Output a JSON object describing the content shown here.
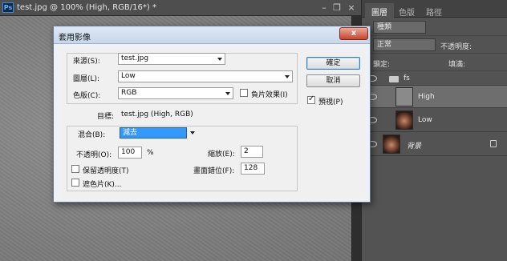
{
  "document": {
    "tab_title": "test.jpg @ 100% (High, RGB/16*) *",
    "app_icon": "Ps",
    "minimize": "–",
    "restore": "❐",
    "close": "×"
  },
  "layers_panel": {
    "tabs": [
      "圖層",
      "色版",
      "路徑"
    ],
    "filter_label": "種類",
    "blend_mode": "正常",
    "opacity_label": "不透明度:",
    "lock_label": "鎖定:",
    "fill_label": "填滿:",
    "layers": [
      {
        "name": "fs",
        "type": "group"
      },
      {
        "name": "High",
        "type": "layer"
      },
      {
        "name": "Low",
        "type": "layer"
      },
      {
        "name": "背景",
        "type": "background"
      }
    ]
  },
  "dialog": {
    "title": "套用影像",
    "close_label": "x",
    "source_label": "來源(S):",
    "source_value": "test.jpg",
    "layer_label": "圖層(L):",
    "layer_value": "Low",
    "channel_label": "色版(C):",
    "channel_value": "RGB",
    "invert_label": "負片效果(I)",
    "target_label": "目標:",
    "target_value": "test.jpg (High, RGB)",
    "blending_label": "混合(B):",
    "blending_value": "減去",
    "opacity_label": "不透明(O):",
    "opacity_value": "100",
    "opacity_unit": "%",
    "scale_label": "縮放(E):",
    "scale_value": "2",
    "offset_label": "畫面錯位(F):",
    "offset_value": "128",
    "preserve_label": "保留透明度(T)",
    "mask_label": "遮色片(K)...",
    "ok_label": "確定",
    "cancel_label": "取消",
    "preview_label": "預視(P)",
    "preview_checked": true
  }
}
